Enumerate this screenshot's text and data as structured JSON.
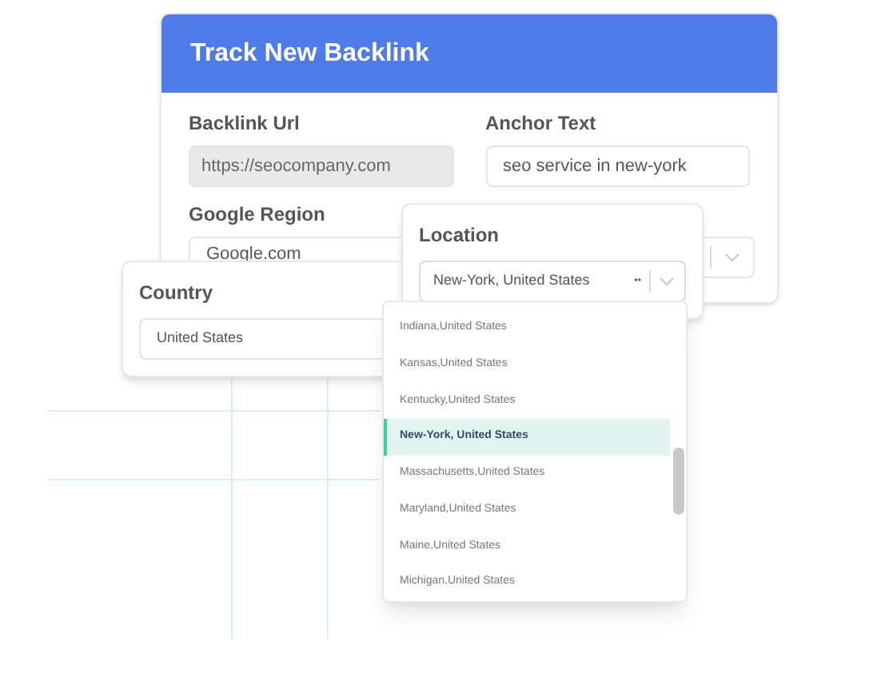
{
  "card": {
    "title": "Track New Backlink"
  },
  "fields": [
    {
      "label": "Backlink Url",
      "value": "https://seocompany.com",
      "disabled": true
    },
    {
      "label": "Anchor Text",
      "value": "seo service in new-york",
      "disabled": false
    }
  ],
  "google_region": {
    "label": "Google Region",
    "value": "Google.com"
  },
  "country": {
    "label": "Country",
    "value": "United States"
  },
  "location": {
    "label": "Location",
    "value": "New-York, United States",
    "clear": "••",
    "expanded": true
  },
  "options": [
    {
      "label": "Indiana,United States",
      "selected": false
    },
    {
      "label": "Kansas,United States",
      "selected": false
    },
    {
      "label": "Kentucky,United States",
      "selected": false
    },
    {
      "label": "New-York, United States",
      "selected": true
    },
    {
      "label": "Massachusetts,United States",
      "selected": false
    },
    {
      "label": "Maryland,United States",
      "selected": false
    },
    {
      "label": "Maine,United States",
      "selected": false
    },
    {
      "label": "Michigan,United States",
      "selected": false
    }
  ]
}
